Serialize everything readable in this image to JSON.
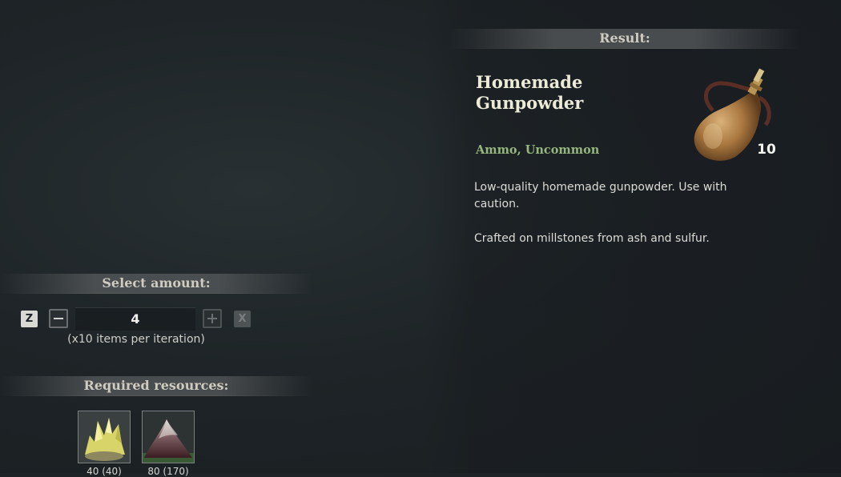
{
  "result": {
    "header": "Result:",
    "title": "Homemade Gunpowder",
    "category": "Ammo, Uncommon",
    "count": "10",
    "description": "Low-quality homemade gunpowder. Use with caution.",
    "crafting_info": "Crafted on millstones from ash and sulfur.",
    "icon": "gunpowder-flask-icon"
  },
  "amount": {
    "header": "Select amount:",
    "min_key": "Z",
    "max_key": "X",
    "value": "4",
    "per_iteration": "(x10 items per iteration)"
  },
  "resources": {
    "header": "Required resources:",
    "items": [
      {
        "icon": "sulfur-icon",
        "count": "40 (40)"
      },
      {
        "icon": "ash-icon",
        "count": "80 (170)"
      }
    ]
  },
  "colors": {
    "category": "#95b77e",
    "title": "#ecebd8",
    "background": "#1e2427"
  }
}
